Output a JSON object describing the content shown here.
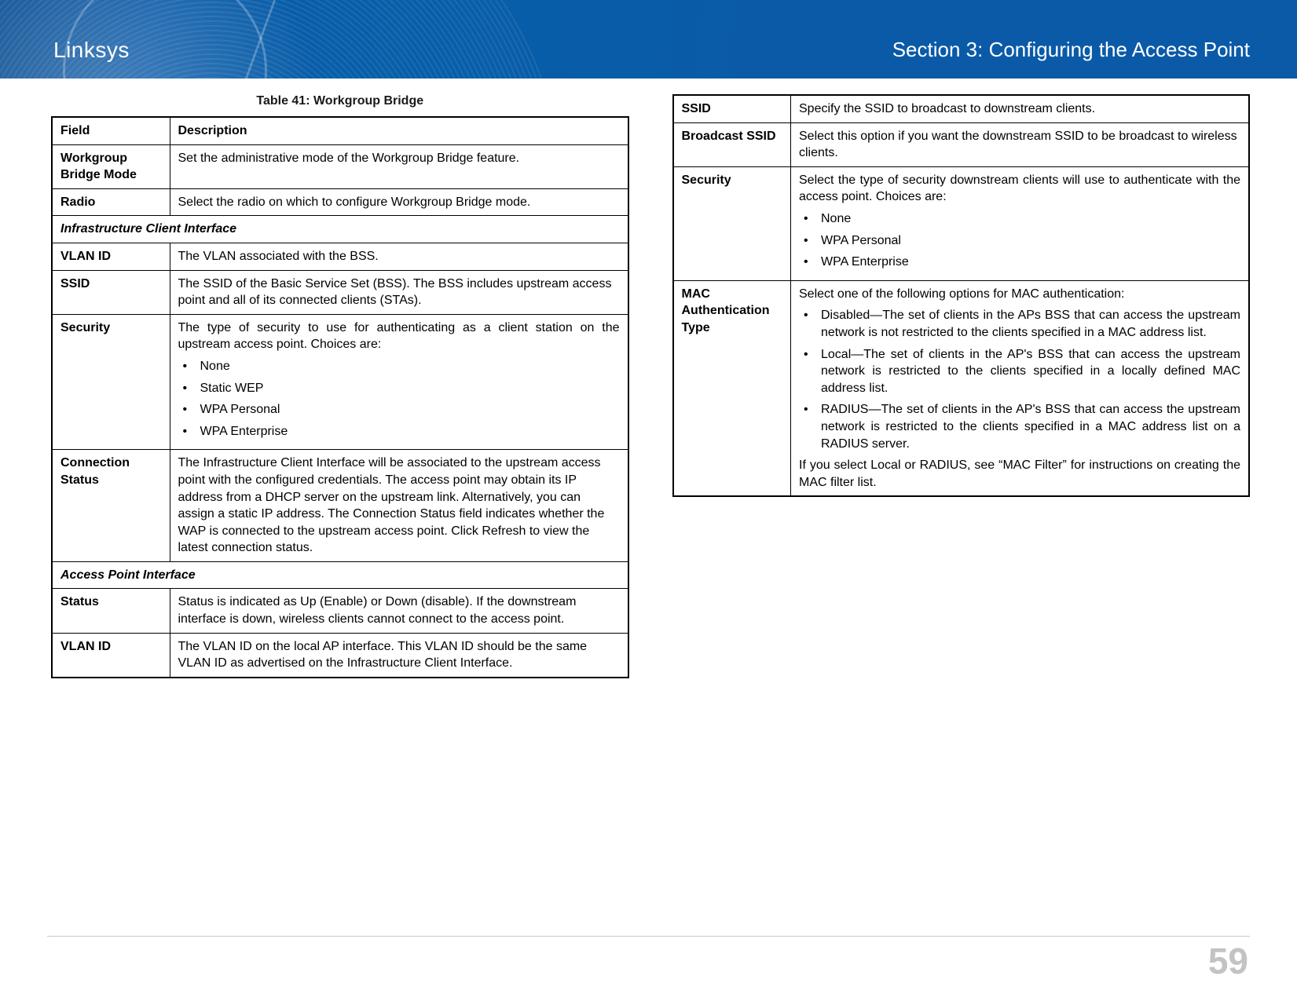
{
  "header": {
    "brand": "Linksys",
    "section": "Section 3:  Configuring the Access Point"
  },
  "caption": "Table 41: Workgroup Bridge",
  "cols": {
    "field": "Field",
    "desc": "Description"
  },
  "subheaders": {
    "ici": "Infrastructure Client Interface",
    "api": "Access Point Interface"
  },
  "left": {
    "r1f": "Workgroup Bridge Mode",
    "r1d": "Set the administrative mode of the Workgroup Bridge feature.",
    "r2f": "Radio",
    "r2d": "Select the radio on which to configure Workgroup Bridge mode.",
    "r3f": "VLAN ID",
    "r3d": "The VLAN associated with the BSS.",
    "r4f": "SSID",
    "r4d": "The SSID of the Basic Service Set (BSS). The BSS includes upstream access point and all of its connected clients (STAs).",
    "r5f": "Security",
    "r5d_intro": "The type of security to use for authenticating as a client station on the upstream access point. Choices are:",
    "r5d_items": {
      "a": "None",
      "b": "Static WEP",
      "c": "WPA Personal",
      "d": "WPA Enterprise"
    },
    "r6f": "Connection Status",
    "r6d": "The Infrastructure Client Interface will be associated to the upstream access point with the configured credentials. The access point may obtain its IP address from a DHCP server on the upstream link. Alternatively, you can assign a static IP address. The Connection Status field indicates whether the WAP is connected to the upstream access point. Click Refresh to view the latest connection status.",
    "r7f": "Status",
    "r7d": "Status is indicated as Up (Enable) or Down (disable). If the downstream interface is down, wireless clients cannot connect to the access point.",
    "r8f": "VLAN ID",
    "r8d": "The VLAN ID on the local AP interface. This VLAN ID should be the same VLAN ID as advertised on the Infrastructure Client Interface."
  },
  "right": {
    "r1f": "SSID",
    "r1d": "Specify the SSID to broadcast to downstream clients.",
    "r2f": "Broadcast SSID",
    "r2d": "Select this option if you want the downstream SSID to be broadcast to wireless clients.",
    "r3f": "Security",
    "r3d_intro": "Select the type of security downstream clients will use to authenticate with the access point. Choices are:",
    "r3d_items": {
      "a": "None",
      "b": "WPA Personal",
      "c": "WPA Enterprise"
    },
    "r4f": "MAC Authentication Type",
    "r4d_intro": "Select one of the following options for MAC authentication:",
    "r4d_items": {
      "a": "Disabled—The set of clients in the APs BSS that can access the upstream network is not restricted to the clients specified in a MAC address list.",
      "b": "Local—The set of clients in the AP's BSS that can access the upstream network is restricted to the clients specified in a locally defined MAC address list.",
      "c": "RADIUS—The set of clients in the AP's BSS that can access the upstream network is restricted to the clients specified in a MAC address list on a RADIUS server."
    },
    "r4d_outro": "If you select Local or RADIUS, see “MAC Filter” for instructions on creating the MAC filter list."
  },
  "page_number": "59"
}
